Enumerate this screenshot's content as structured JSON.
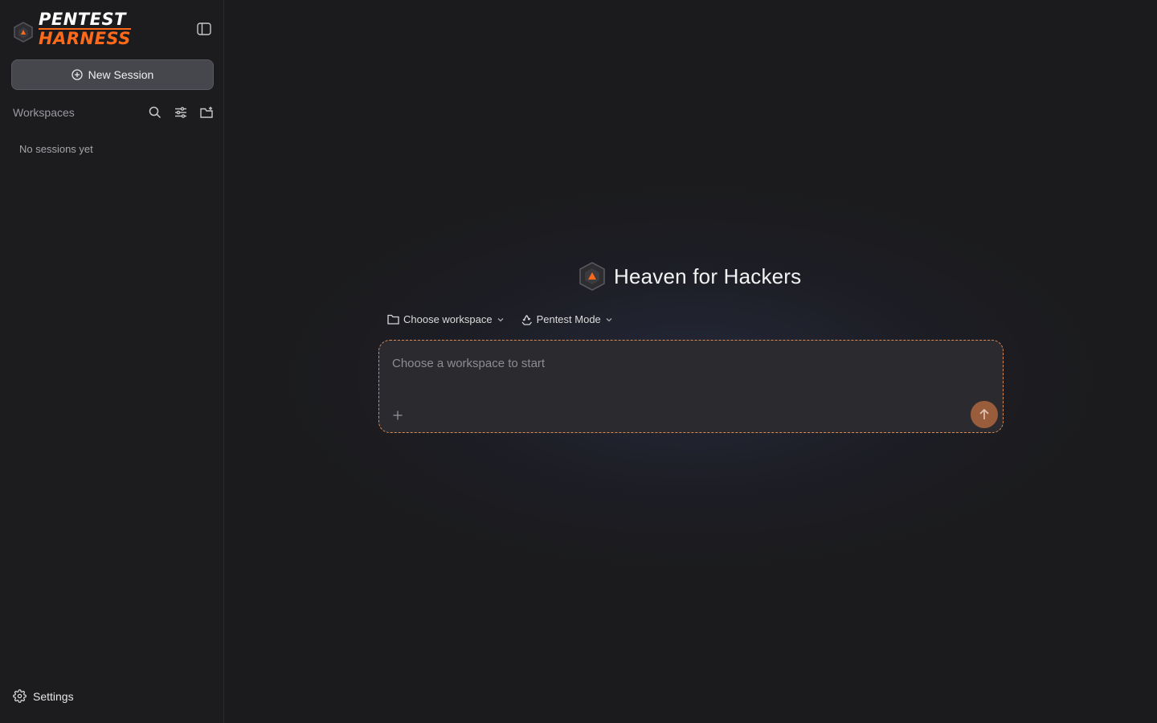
{
  "app": {
    "brand_line1": "PENTEST",
    "brand_line2": "HARNESS",
    "accent_color": "#ff6a1a"
  },
  "sidebar": {
    "new_session_label": "New Session",
    "workspaces_label": "Workspaces",
    "empty_text": "No sessions yet",
    "settings_label": "Settings",
    "icons": [
      "sidebar-toggle-icon",
      "plus-circle-icon",
      "search-icon",
      "sliders-icon",
      "folder-plus-icon",
      "gear-icon"
    ]
  },
  "main": {
    "hero_title": "Heaven for Hackers",
    "workspace_selector_label": "Choose workspace",
    "mode_selector_label": "Pentest Mode",
    "composer_placeholder": "Choose a workspace to start",
    "send_color": "#9a5d3c",
    "border_color": "#d98a55",
    "icons": [
      "folder-icon",
      "chevron-down-icon",
      "recycle-icon",
      "plus-icon",
      "arrow-up-icon"
    ]
  }
}
